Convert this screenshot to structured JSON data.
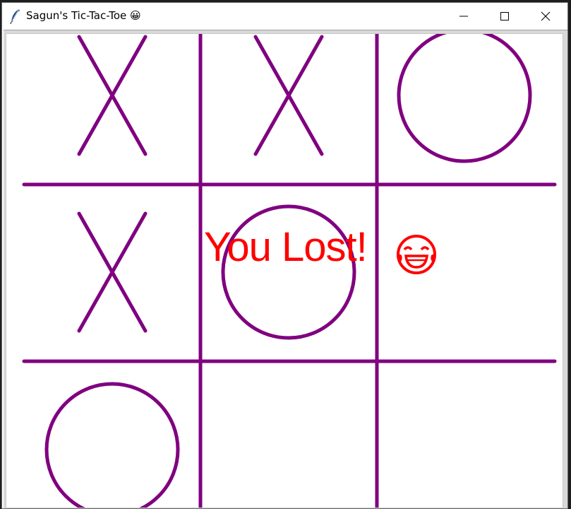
{
  "window": {
    "title": "Sagun's Tic-Tac-Toe 😀",
    "controls": [
      "minimize",
      "maximize",
      "close"
    ]
  },
  "board": {
    "cells": [
      [
        "X",
        "X",
        "O"
      ],
      [
        "X",
        "O",
        ""
      ],
      [
        "O",
        "",
        ""
      ]
    ],
    "line_color": "#800080",
    "mark_color": "#800080"
  },
  "status": {
    "text": "You Lost!",
    "emoji": "face-with-tears-of-joy-icon",
    "color": "#ff0000"
  }
}
